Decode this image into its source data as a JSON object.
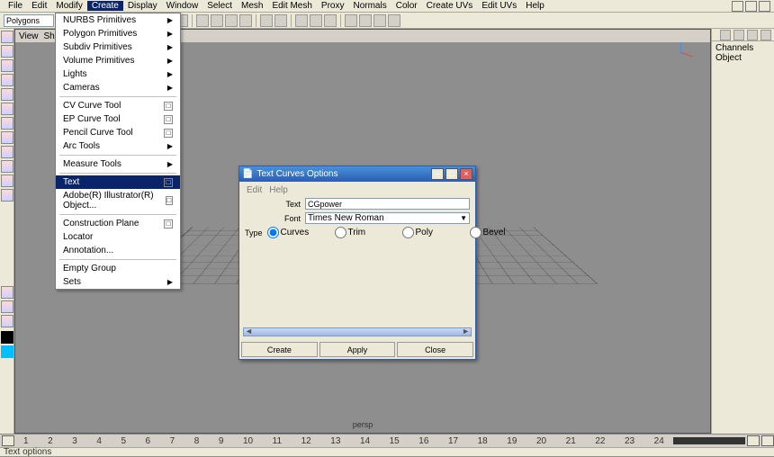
{
  "menubar": {
    "items": [
      "File",
      "Edit",
      "Modify",
      "Create",
      "Display",
      "Window",
      "Select",
      "Mesh",
      "Edit Mesh",
      "Proxy",
      "Normals",
      "Color",
      "Create UVs",
      "Edit UVs",
      "Help"
    ],
    "active_index": 3
  },
  "shelf": {
    "dropdown": "Polygons"
  },
  "viewhdr": {
    "items": [
      "View",
      "Shading"
    ]
  },
  "right_panel": {
    "tabs": [
      "Channels",
      "Object"
    ]
  },
  "create_menu": {
    "groups": [
      {
        "items": [
          {
            "label": "NURBS Primitives",
            "sub": true
          },
          {
            "label": "Polygon Primitives",
            "sub": true
          },
          {
            "label": "Subdiv Primitives",
            "sub": true
          },
          {
            "label": "Volume Primitives",
            "sub": true
          },
          {
            "label": "Lights",
            "sub": true
          },
          {
            "label": "Cameras",
            "sub": true
          }
        ]
      },
      {
        "items": [
          {
            "label": "CV Curve Tool",
            "opt": true
          },
          {
            "label": "EP Curve Tool",
            "opt": true
          },
          {
            "label": "Pencil Curve Tool",
            "opt": true
          },
          {
            "label": "Arc Tools",
            "sub": true
          }
        ]
      },
      {
        "items": [
          {
            "label": "Measure Tools",
            "sub": true
          }
        ]
      },
      {
        "items": [
          {
            "label": "Text",
            "opt": true,
            "hilite": true
          },
          {
            "label": "Adobe(R) Illustrator(R) Object...",
            "opt": true
          }
        ]
      },
      {
        "items": [
          {
            "label": "Construction Plane",
            "opt": true
          },
          {
            "label": "Locator"
          },
          {
            "label": "Annotation..."
          }
        ]
      },
      {
        "items": [
          {
            "label": "Empty Group"
          },
          {
            "label": "Sets",
            "sub": true
          }
        ]
      }
    ]
  },
  "dialog": {
    "title": "Text Curves Options",
    "menu": [
      "Edit",
      "Help"
    ],
    "labels": {
      "text": "Text",
      "font": "Font",
      "type": "Type"
    },
    "text_value": "CGpower",
    "font_value": "Times New Roman",
    "type_options": [
      "Curves",
      "Trim",
      "Poly",
      "Bevel"
    ],
    "type_selected_index": 0,
    "buttons": {
      "create": "Create",
      "apply": "Apply",
      "close": "Close"
    },
    "winbtns": {
      "min": "–",
      "max": "□",
      "close": "×"
    }
  },
  "timeline": {
    "frames": [
      "1",
      "2",
      "3",
      "4",
      "5",
      "6",
      "7",
      "8",
      "9",
      "10",
      "11",
      "12",
      "13",
      "14",
      "15",
      "16",
      "17",
      "18",
      "19",
      "20",
      "21",
      "22",
      "23",
      "24"
    ]
  },
  "viewport": {
    "label": "persp"
  },
  "status": {
    "text": "Text options"
  }
}
